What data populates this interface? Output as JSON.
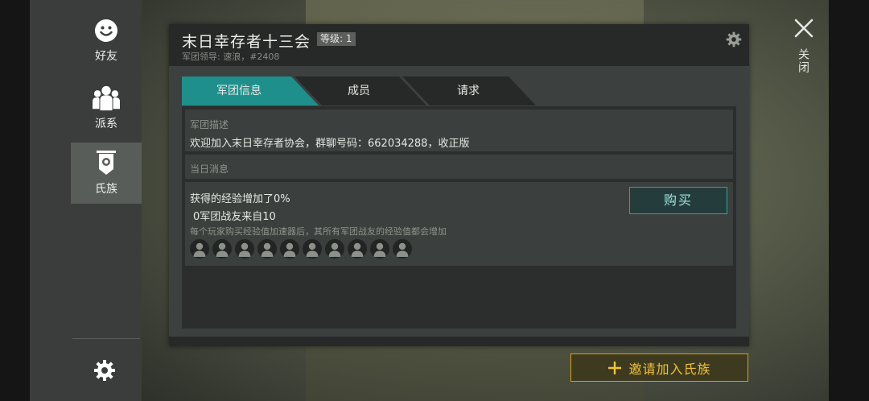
{
  "sidebar": {
    "items": [
      {
        "label": "好友",
        "icon": "smiley-icon"
      },
      {
        "label": "派系",
        "icon": "group-icon"
      },
      {
        "label": "氏族",
        "icon": "clan-banner-icon"
      }
    ],
    "settings_icon": "gear-icon"
  },
  "clan": {
    "name": "末日幸存者十三会",
    "level_label": "等级: 1",
    "leader_line": "军团领导: 速浪，#2408"
  },
  "tabs": [
    {
      "label": "军团信息",
      "active": true
    },
    {
      "label": "成员",
      "active": false
    },
    {
      "label": "请求",
      "active": false
    }
  ],
  "description": {
    "label": "军团描述",
    "text": "欢迎加入末日幸存者协会，群聊号码：662034288，收正版"
  },
  "daily": {
    "label": "当日消息"
  },
  "exp": {
    "line1": "获得的经验增加了0%",
    "line2": "0军团战友来自10",
    "note": "每个玩家购买经验值加速器后，其所有军团战友的经验值都会增加",
    "slots": 10,
    "buy_label": "购买"
  },
  "close_label": "关闭",
  "invite_label": "邀请加入氏族",
  "colors": {
    "accent_teal": "#1f8f8c",
    "invite_gold": "#d7a21a"
  }
}
